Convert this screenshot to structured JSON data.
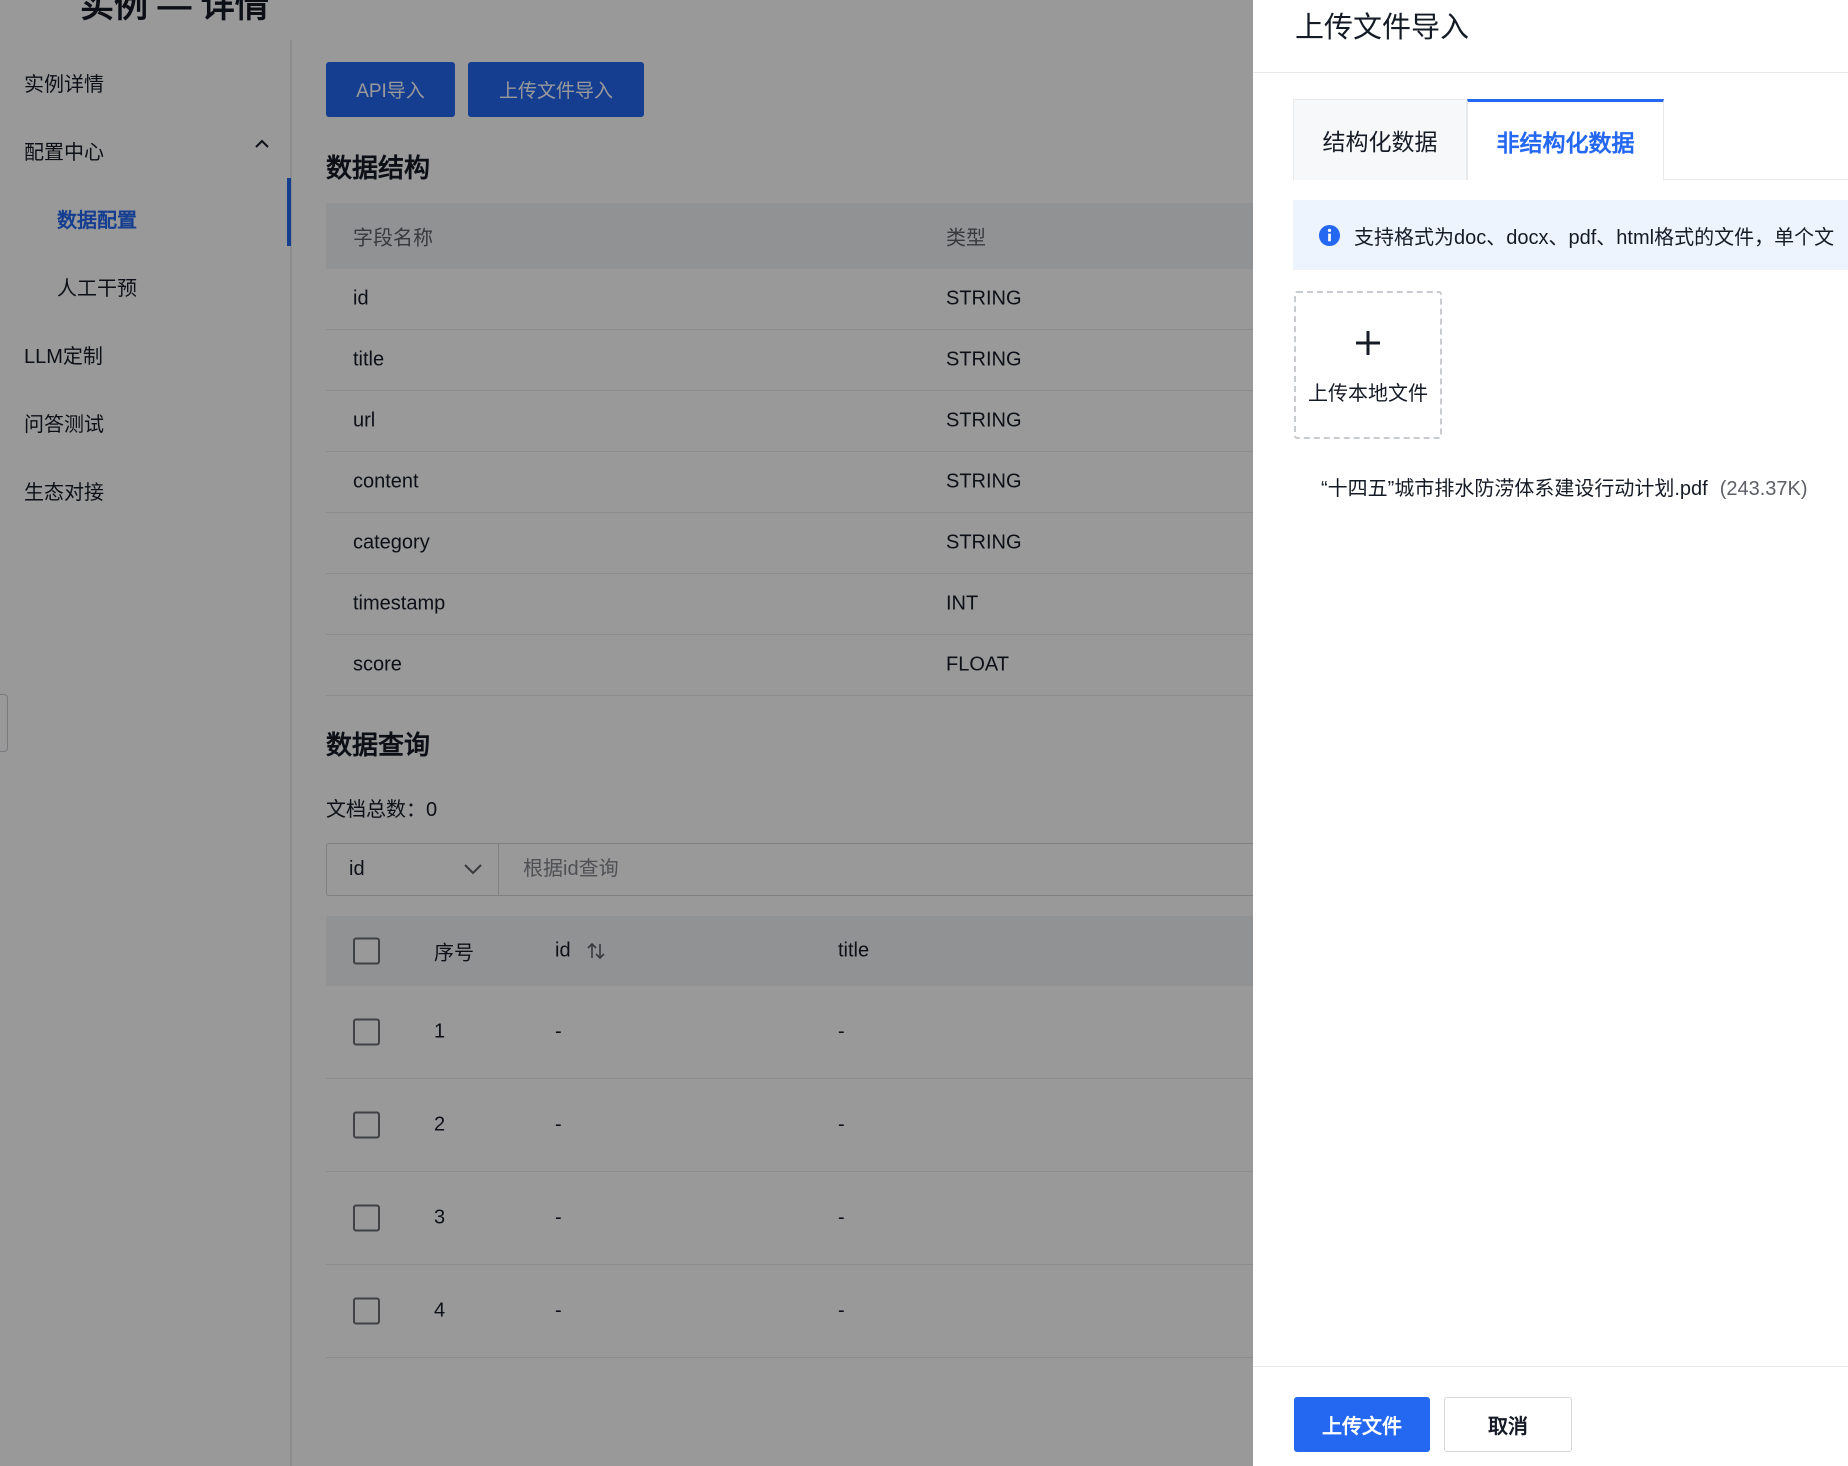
{
  "page": {
    "title_partial": "实例 — 详情"
  },
  "sidebar": {
    "items": [
      {
        "label": "实例详情"
      },
      {
        "label": "配置中心"
      },
      {
        "label": "数据配置"
      },
      {
        "label": "人工干预"
      },
      {
        "label": "LLM定制"
      },
      {
        "label": "问答测试"
      },
      {
        "label": "生态对接"
      }
    ],
    "active_item": "数据配置",
    "expanded_group": "配置中心"
  },
  "toolbar": {
    "api_import_label": "API导入",
    "file_import_label": "上传文件导入"
  },
  "schema": {
    "title": "数据结构",
    "columns": [
      "字段名称",
      "类型"
    ],
    "rows": [
      {
        "name": "id",
        "type": "STRING"
      },
      {
        "name": "title",
        "type": "STRING"
      },
      {
        "name": "url",
        "type": "STRING"
      },
      {
        "name": "content",
        "type": "STRING"
      },
      {
        "name": "category",
        "type": "STRING"
      },
      {
        "name": "timestamp",
        "type": "INT"
      },
      {
        "name": "score",
        "type": "FLOAT"
      }
    ]
  },
  "query": {
    "title": "数据查询",
    "doc_count_label": "文档总数：0",
    "field_select_value": "id",
    "search_placeholder": "根据id查询",
    "columns": [
      "序号",
      "id",
      "title"
    ],
    "rows": [
      {
        "index": "1",
        "id": "-",
        "title": "-"
      },
      {
        "index": "2",
        "id": "-",
        "title": "-"
      },
      {
        "index": "3",
        "id": "-",
        "title": "-"
      },
      {
        "index": "4",
        "id": "-",
        "title": "-"
      }
    ]
  },
  "drawer": {
    "title": "上传文件导入",
    "tabs": [
      {
        "label": "结构化数据",
        "active": false
      },
      {
        "label": "非结构化数据",
        "active": true
      }
    ],
    "info_text": "支持格式为doc、docx、pdf、html格式的文件，单个文",
    "upload_label": "上传本地文件",
    "file": {
      "name": "“十四五”城市排水防涝体系建设行动计划.pdf",
      "size": "(243.37K)"
    },
    "submit_label": "上传文件",
    "cancel_label": "取消"
  },
  "colors": {
    "accent": "#2468f2",
    "mask": "rgba(0,0,0,0.40)",
    "info_bg": "#edf4fe"
  },
  "icons": [
    "chevron-up-icon",
    "chevron-down-icon",
    "sort-icon",
    "info-icon",
    "plus-icon"
  ]
}
